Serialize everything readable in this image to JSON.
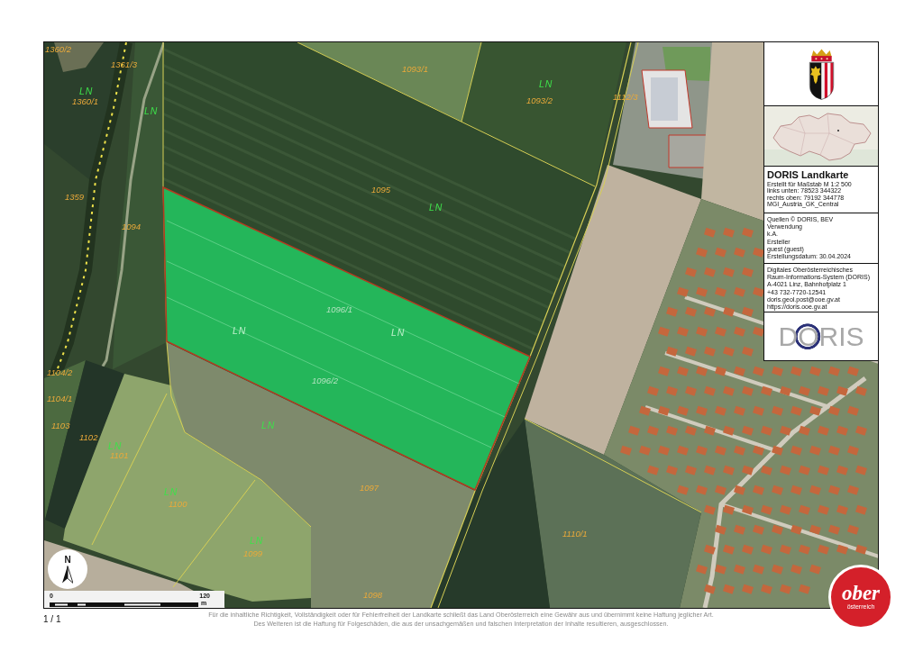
{
  "map": {
    "labels": [
      {
        "text": "1360/2",
        "kind": "parcel-number"
      },
      {
        "text": "1361/3",
        "kind": "parcel-number"
      },
      {
        "text": "LN",
        "kind": "land-use"
      },
      {
        "text": "1360/1",
        "kind": "parcel-number"
      },
      {
        "text": "LN",
        "kind": "land-use"
      },
      {
        "text": "1359",
        "kind": "parcel-number"
      },
      {
        "text": "1094",
        "kind": "parcel-number"
      },
      {
        "text": "1095",
        "kind": "parcel-number"
      },
      {
        "text": "LN",
        "kind": "land-use"
      },
      {
        "text": "1093/1",
        "kind": "parcel-number"
      },
      {
        "text": "LN",
        "kind": "land-use"
      },
      {
        "text": "1093/2",
        "kind": "parcel-number"
      },
      {
        "text": "1112/3",
        "kind": "parcel-number"
      },
      {
        "text": "1096/1",
        "kind": "parcel-number"
      },
      {
        "text": "LN",
        "kind": "land-use"
      },
      {
        "text": "LN",
        "kind": "land-use"
      },
      {
        "text": "1096/2",
        "kind": "parcel-number"
      },
      {
        "text": "LN",
        "kind": "land-use"
      },
      {
        "text": "1097",
        "kind": "parcel-number"
      },
      {
        "text": "1110/1",
        "kind": "parcel-number"
      },
      {
        "text": "1098",
        "kind": "parcel-number"
      },
      {
        "text": "1103",
        "kind": "parcel-number"
      },
      {
        "text": "1102",
        "kind": "parcel-number"
      },
      {
        "text": "LN",
        "kind": "land-use"
      },
      {
        "text": "1101",
        "kind": "parcel-number"
      },
      {
        "text": "LN",
        "kind": "land-use"
      },
      {
        "text": "1100",
        "kind": "parcel-number"
      },
      {
        "text": "LN",
        "kind": "land-use"
      },
      {
        "text": "1099",
        "kind": "parcel-number"
      },
      {
        "text": "1104/2",
        "kind": "parcel-number"
      },
      {
        "text": "1104/1",
        "kind": "parcel-number"
      }
    ],
    "north_arrow": {
      "label": "N"
    },
    "scale_bar": {
      "start": "0",
      "end": "120",
      "unit": "m"
    }
  },
  "info_panel": {
    "title": "DORIS Landkarte",
    "map_details": [
      "Erstellt für Maßstab M 1:2 500",
      "links unten: 78523 344322",
      "rechts oben: 79192 344778",
      "MGI_Austria_GK_Central"
    ],
    "metadata": [
      "Quellen © DORIS, BEV",
      "Verwendung",
      "k.A.",
      "Ersteller",
      "guest (guest)",
      "Erstellungsdatum: 30.04.2024"
    ],
    "contact": [
      "Digitales Oberösterreichisches",
      "Raum-Informations-System (DORIS)",
      "A-4021 Linz, Bahnhofplatz 1",
      "+43 732-7720-12541",
      "doris.geol.post@ooe.gv.at",
      "https://doris.ooe.gv.at"
    ],
    "logo_text": "DORIS"
  },
  "footer": {
    "page": "1 / 1",
    "disclaimer": [
      "Für die inhaltliche Richtigkeit, Vollständigkeit oder für Fehlerfreiheit der Landkarte schließt das Land Oberösterreich eine Gewähr aus und übernimmt keine Haftung jeglicher Art.",
      "Des Weiteren ist die Haftung für Folgeschäden, die aus der unsachgemäßen und falschen Interpretation der Inhalte resultieren, ausgeschlossen."
    ]
  },
  "brand_logo": {
    "top": "ober",
    "bottom": "österreich"
  }
}
